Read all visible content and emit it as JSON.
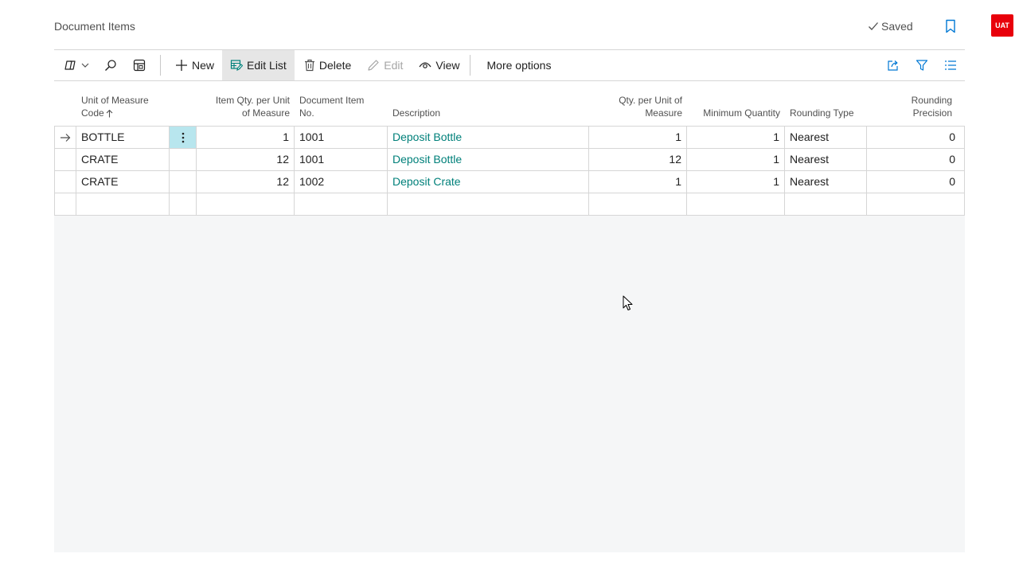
{
  "page": {
    "title": "Document Items",
    "saved_label": "Saved",
    "env_badge": "UAT"
  },
  "icons": {
    "saved": "check-icon",
    "bookmark": "bookmark-icon",
    "views": "views-icon",
    "search": "search-icon",
    "analyze": "analyze-icon",
    "new": "plus-icon",
    "edit_list": "edit-list-icon",
    "delete": "trash-icon",
    "edit": "pencil-icon",
    "view": "eye-icon",
    "share": "share-icon",
    "filter": "filter-icon",
    "list_layout": "list-icon"
  },
  "toolbar": {
    "new_label": "New",
    "edit_list_label": "Edit List",
    "delete_label": "Delete",
    "edit_label": "Edit",
    "view_label": "View",
    "more_options_label": "More options"
  },
  "table": {
    "headers": {
      "uom_code_line1": "Unit of Measure",
      "uom_code_line2": "Code",
      "item_qty_line1": "Item Qty. per Unit",
      "item_qty_line2": "of Measure",
      "doc_item_line1": "Document Item",
      "doc_item_line2": "No.",
      "description": "Description",
      "qty_per_line1": "Qty. per Unit of",
      "qty_per_line2": "Measure",
      "min_qty": "Minimum Quantity",
      "rounding_type": "Rounding Type",
      "rounding_precision_line1": "Rounding",
      "rounding_precision_line2": "Precision"
    },
    "rows": [
      {
        "uom_code": "BOTTLE",
        "item_qty": "1",
        "doc_item_no": "1001",
        "description": "Deposit Bottle",
        "qty_per_uom": "1",
        "min_qty": "1",
        "rounding_type": "Nearest",
        "rounding_precision": "0"
      },
      {
        "uom_code": "CRATE",
        "item_qty": "12",
        "doc_item_no": "1001",
        "description": "Deposit Bottle",
        "qty_per_uom": "12",
        "min_qty": "1",
        "rounding_type": "Nearest",
        "rounding_precision": "0"
      },
      {
        "uom_code": "CRATE",
        "item_qty": "12",
        "doc_item_no": "1002",
        "description": "Deposit Crate",
        "qty_per_uom": "1",
        "min_qty": "1",
        "rounding_type": "Nearest",
        "rounding_precision": "0"
      }
    ]
  },
  "colors": {
    "accent": "#00807a",
    "selected_cell": "#b8e6ee",
    "badge": "#e8000b",
    "link_icon": "#0078d4"
  }
}
